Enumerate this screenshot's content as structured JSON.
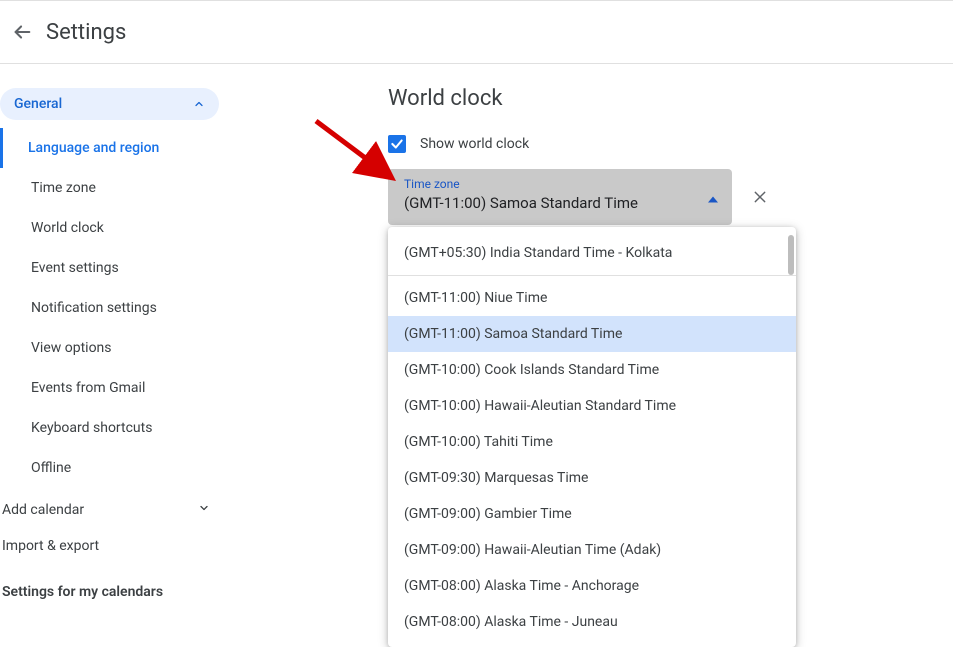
{
  "header": {
    "title": "Settings"
  },
  "sidebar": {
    "general_label": "General",
    "items": [
      "Language and region",
      "Time zone",
      "World clock",
      "Event settings",
      "Notification settings",
      "View options",
      "Events from Gmail",
      "Keyboard shortcuts",
      "Offline"
    ],
    "selected_index": 0,
    "add_calendar_label": "Add calendar",
    "import_export_label": "Import & export",
    "footer_label": "Settings for my calendars"
  },
  "content": {
    "section_title": "World clock",
    "checkbox_label": "Show world clock",
    "checkbox_checked": true,
    "dropdown": {
      "float_label": "Time zone",
      "value": "(GMT-11:00) Samoa Standard Time"
    },
    "menu": {
      "top_item": "(GMT+05:30) India Standard Time - Kolkata",
      "items": [
        "(GMT-11:00) Niue Time",
        "(GMT-11:00) Samoa Standard Time",
        "(GMT-10:00) Cook Islands Standard Time",
        "(GMT-10:00) Hawaii-Aleutian Standard Time",
        "(GMT-10:00) Tahiti Time",
        "(GMT-09:30) Marquesas Time",
        "(GMT-09:00) Gambier Time",
        "(GMT-09:00) Hawaii-Aleutian Time (Adak)",
        "(GMT-08:00) Alaska Time - Anchorage",
        "(GMT-08:00) Alaska Time - Juneau"
      ],
      "selected_index": 1
    }
  }
}
